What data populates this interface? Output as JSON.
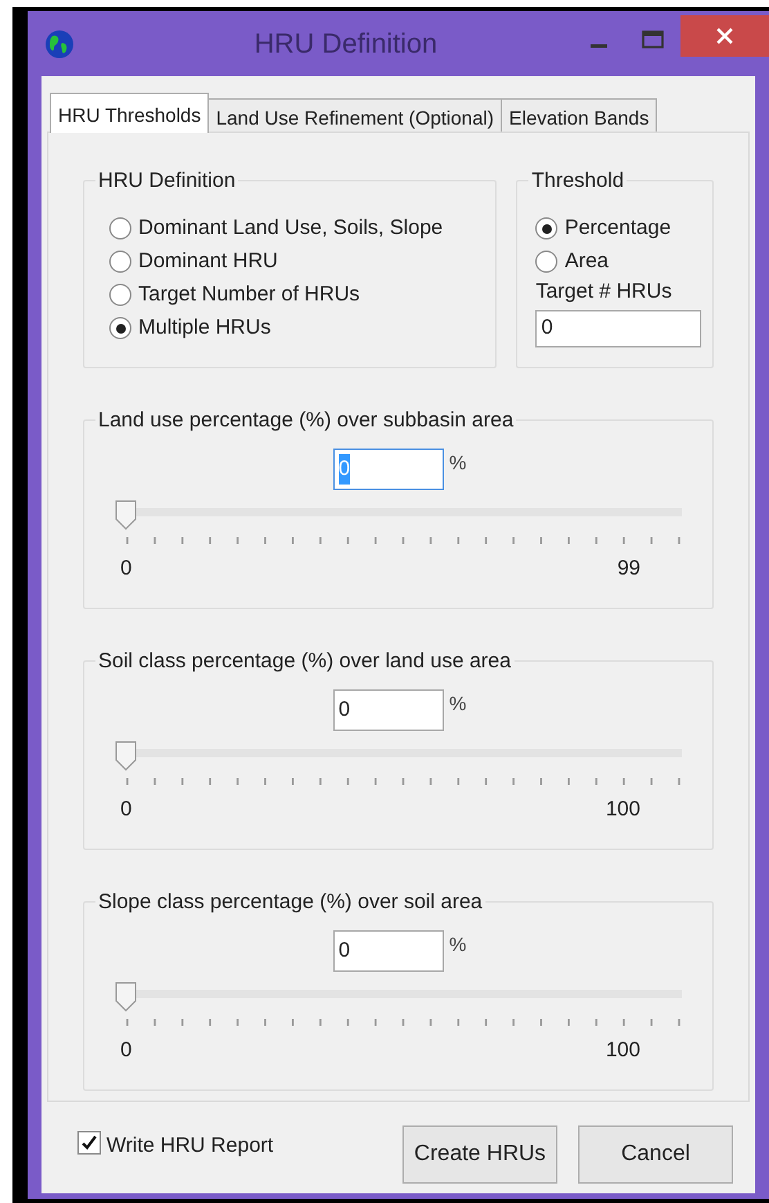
{
  "window": {
    "title": "HRU Definition"
  },
  "tabs": [
    {
      "label": "HRU Thresholds",
      "selected": true
    },
    {
      "label": "Land Use Refinement (Optional)",
      "selected": false
    },
    {
      "label": "Elevation Bands",
      "selected": false
    }
  ],
  "hru_definition": {
    "title": "HRU Definition",
    "options": [
      {
        "label": "Dominant Land Use, Soils, Slope",
        "selected": false
      },
      {
        "label": "Dominant HRU",
        "selected": false
      },
      {
        "label": "Target Number of HRUs",
        "selected": false
      },
      {
        "label": "Multiple HRUs",
        "selected": true
      }
    ]
  },
  "threshold": {
    "title": "Threshold",
    "options": [
      {
        "label": "Percentage",
        "selected": true
      },
      {
        "label": "Area",
        "selected": false
      }
    ],
    "target_label": "Target # HRUs",
    "target_value": "0"
  },
  "sliders": [
    {
      "title": "Land use percentage (%) over subbasin area",
      "value": "0",
      "focused": true,
      "unit": "%",
      "level": 0,
      "min": "0",
      "max": "99"
    },
    {
      "title": "Soil class percentage (%) over land use area",
      "value": "0",
      "focused": false,
      "unit": "%",
      "level": 0,
      "min": "0",
      "max": "100"
    },
    {
      "title": "Slope class percentage (%) over soil area",
      "value": "0",
      "focused": false,
      "unit": "%",
      "level": 0,
      "min": "0",
      "max": "100"
    }
  ],
  "report": {
    "label": "Write HRU Report",
    "checked": true
  },
  "buttons": [
    "Create HRUs",
    "Cancel"
  ]
}
